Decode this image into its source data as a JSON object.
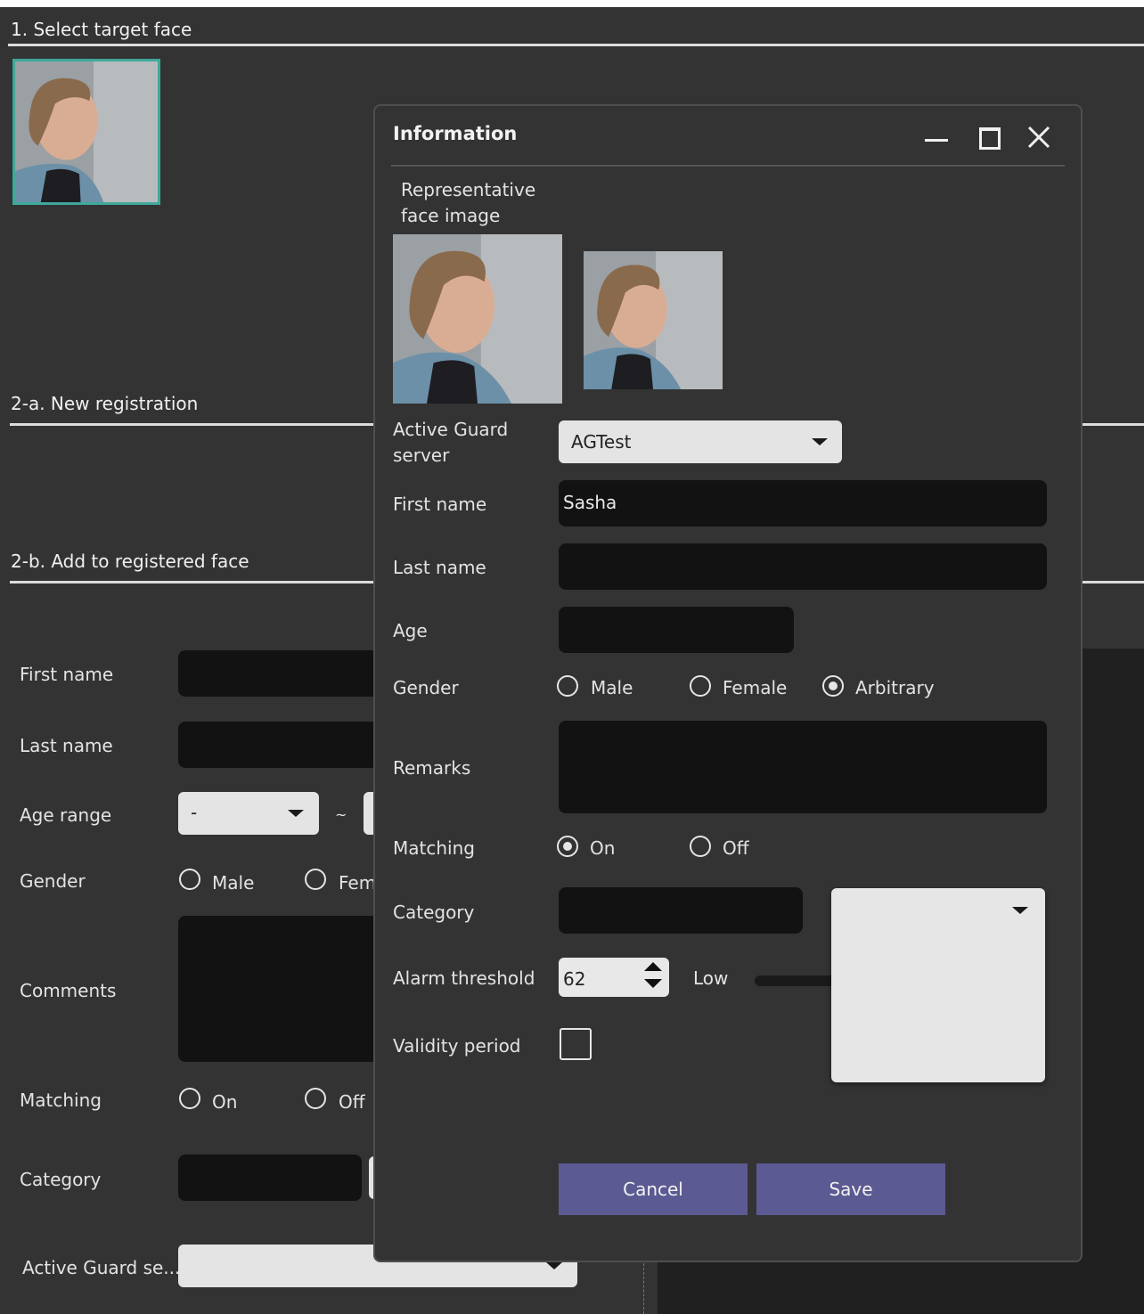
{
  "background": {
    "section1_title": "1. Select target face",
    "section2a_title": "2-a. New registration",
    "section2b_title": "2-b. Add to registered face",
    "form": {
      "first_name_label": "First name",
      "last_name_label": "Last name",
      "age_range_label": "Age range",
      "age_range_value": "-",
      "age_range_sep": "~",
      "gender_label": "Gender",
      "gender_male": "Male",
      "gender_female": "Fem",
      "comments_label": "Comments",
      "matching_label": "Matching",
      "matching_on": "On",
      "matching_off": "Off",
      "category_label": "Category",
      "active_guard_label": "Active Guard se..."
    }
  },
  "dialog": {
    "title": "Information",
    "rep_image_label": "Representative face image",
    "active_guard_label_1": "Active Guard",
    "active_guard_label_2": "server",
    "active_guard_value": "AGTest",
    "first_name_label": "First name",
    "first_name_value": "Sasha",
    "last_name_label": "Last name",
    "last_name_value": "",
    "age_label": "Age",
    "age_value": "",
    "gender_label": "Gender",
    "gender_options": [
      "Male",
      "Female",
      "Arbitrary"
    ],
    "gender_selected": "Arbitrary",
    "remarks_label": "Remarks",
    "matching_label": "Matching",
    "matching_options": [
      "On",
      "Off"
    ],
    "matching_selected": "On",
    "category_label": "Category",
    "alarm_threshold_label": "Alarm threshold",
    "alarm_threshold_value": "62",
    "low_label": "Low",
    "validity_label": "Validity period",
    "cancel_label": "Cancel",
    "save_label": "Save"
  },
  "icons": [
    "minimize-icon",
    "maximize-icon",
    "close-icon",
    "chevron-down-icon",
    "spin-up-icon",
    "spin-down-icon"
  ],
  "colors": {
    "background": "#333333",
    "input_dark": "#121212",
    "combo_light": "#e4e4e4",
    "button": "#5b5a92",
    "thumb_border": "#3ea89a"
  }
}
